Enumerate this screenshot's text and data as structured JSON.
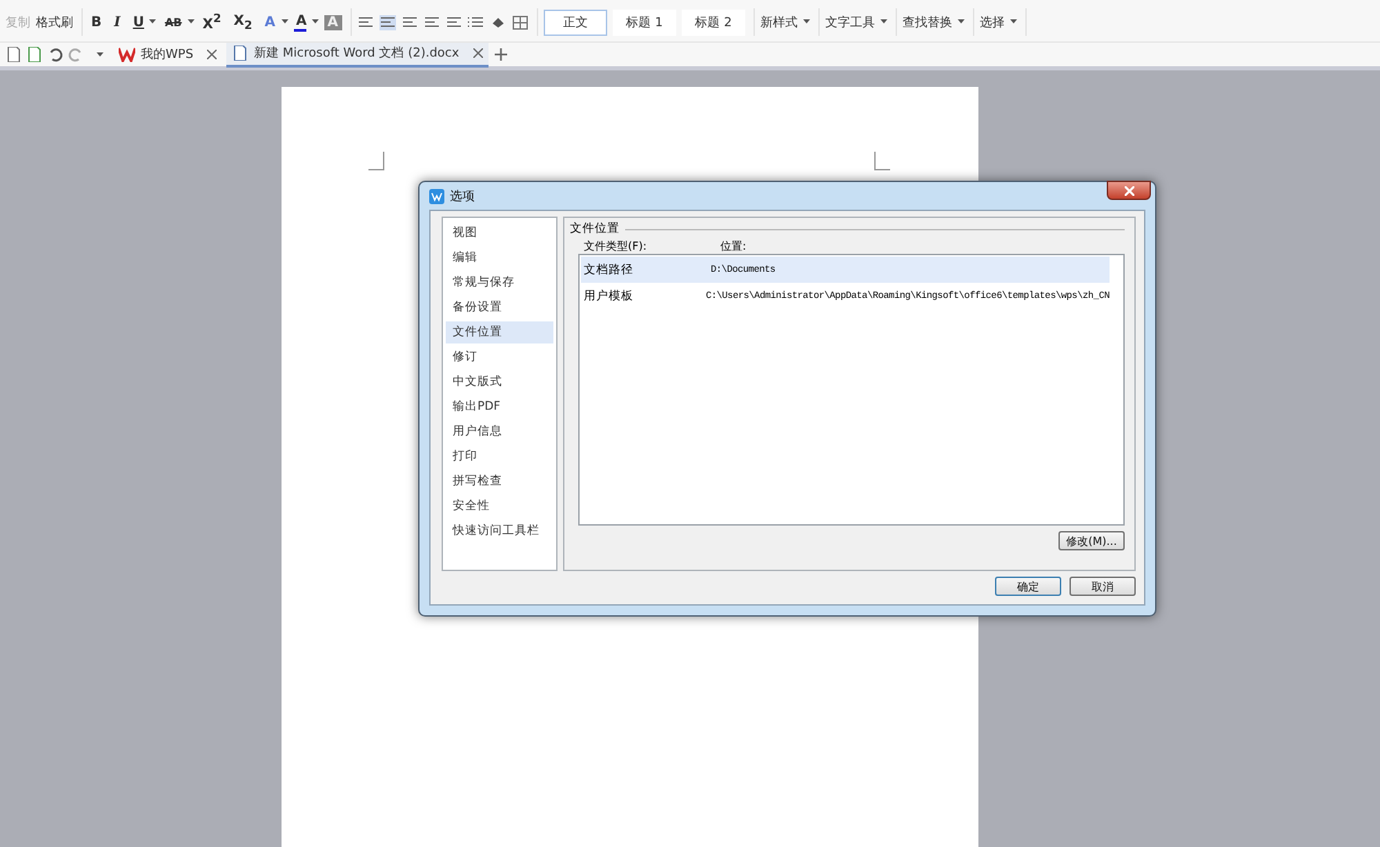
{
  "ribbon": {
    "clipboard": [
      {
        "label": "复制",
        "disabled": true
      },
      {
        "label": "格式刷",
        "disabled": false
      }
    ],
    "font_buttons": [
      {
        "label": "B",
        "kind": "bold",
        "dropdown": false
      },
      {
        "label": "I",
        "kind": "italic",
        "dropdown": false
      },
      {
        "label": "U",
        "kind": "underline",
        "dropdown": true
      },
      {
        "label": "AB",
        "kind": "strike",
        "dropdown": true
      },
      {
        "label": "X$^{2}$",
        "kind": "plain",
        "dropdown": false
      },
      {
        "label": "X$_{2}$",
        "kind": "plain",
        "dropdown": false
      },
      {
        "label": "A",
        "kind": "effect",
        "dropdown": true
      },
      {
        "label": "A",
        "kind": "color",
        "dropdown": true
      },
      {
        "label": "A",
        "kind": "shade",
        "dropdown": false
      }
    ],
    "styles": [
      {
        "label": "正文",
        "selected": true
      },
      {
        "label": "标题 1",
        "selected": false
      },
      {
        "label": "标题 2",
        "selected": false
      }
    ],
    "tools": [
      "新样式",
      "文字工具",
      "查找替换",
      "选择"
    ]
  },
  "tabs": [
    {
      "label": "我的WPS",
      "kind": "home",
      "selected": false
    },
    {
      "label": "新建 Microsoft Word 文档 (2).docx",
      "kind": "doc",
      "selected": true
    }
  ],
  "dialog": {
    "title": "选项",
    "sidebar": [
      {
        "label": "视图",
        "selected": false
      },
      {
        "label": "编辑",
        "selected": false
      },
      {
        "label": "常规与保存",
        "selected": false
      },
      {
        "label": "备份设置",
        "selected": false
      },
      {
        "label": "文件位置",
        "selected": true
      },
      {
        "label": "修订",
        "selected": false
      },
      {
        "label": "中文版式",
        "selected": false
      },
      {
        "label": "输出PDF",
        "selected": false
      },
      {
        "label": "用户信息",
        "selected": false
      },
      {
        "label": "打印",
        "selected": false
      },
      {
        "label": "拼写检查",
        "selected": false
      },
      {
        "label": "安全性",
        "selected": false
      },
      {
        "label": "快速访问工具栏",
        "selected": false
      }
    ],
    "group_title": "文件位置",
    "columns": [
      "文件类型(F):",
      "位置:"
    ],
    "rows": [
      {
        "type": "文档路径",
        "location": "D:\\Documents",
        "selected": true
      },
      {
        "type": "用户模板",
        "location": "C:\\Users\\Administrator\\AppData\\Roaming\\Kingsoft\\office6\\templates\\wps\\zh_CN",
        "selected": false
      }
    ],
    "modify_button": "修改(M)...",
    "buttons": [
      {
        "label": "确定",
        "kind": "default"
      },
      {
        "label": "取消",
        "kind": "normal"
      }
    ]
  }
}
